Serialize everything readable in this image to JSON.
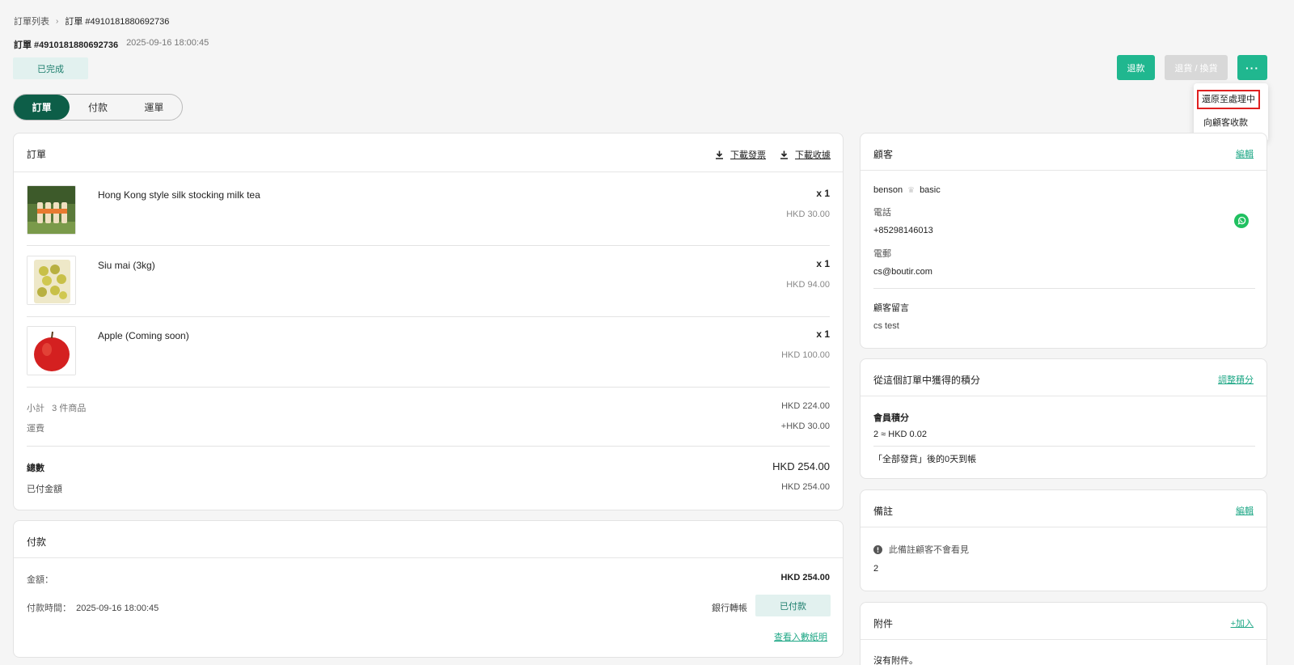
{
  "breadcrumb": {
    "parent": "訂單列表",
    "separator": "›",
    "current": "訂單 #4910181880692736"
  },
  "order": {
    "number": "訂單 #4910181880692736",
    "datetime": "2025-09-16 18:00:45",
    "status": "已完成"
  },
  "actions": {
    "refund": "退款",
    "return_exchange": "退貨 / 換貨",
    "more": "···"
  },
  "more_menu": {
    "items": [
      "還原至處理中",
      "向顧客收款"
    ]
  },
  "tabs": [
    "訂單",
    "付款",
    "運單"
  ],
  "order_card": {
    "title": "訂單",
    "download_invoice": "下載發票",
    "download_receipt": "下載收據",
    "items": [
      {
        "name": "Hong Kong style silk stocking milk tea",
        "qty": "x 1",
        "price": "HKD 30.00"
      },
      {
        "name": "Siu mai (3kg)",
        "qty": "x 1",
        "price": "HKD 94.00"
      },
      {
        "name": "Apple (Coming soon)",
        "qty": "x 1",
        "price": "HKD 100.00"
      }
    ],
    "subtotal_label": "小計",
    "subtotal_count": "3 件商品",
    "subtotal_value": "HKD 224.00",
    "shipping_label": "運費",
    "shipping_value": "+HKD 30.00",
    "total_label": "總數",
    "total_value": "HKD 254.00",
    "paid_label": "已付金額",
    "paid_value": "HKD 254.00"
  },
  "payment_card": {
    "title": "付款",
    "amount_label": "金額：",
    "amount_value": "HKD 254.00",
    "time_label": "付款時間：",
    "time_value": "2025-09-16 18:00:45",
    "method": "銀行轉帳",
    "status": "已付款",
    "view_link": "查看入數紙明"
  },
  "customer_card": {
    "title": "顧客",
    "edit": "編輯",
    "name": "benson",
    "tier": "basic",
    "phone_label": "電話",
    "phone": "+85298146013",
    "email_label": "電郵",
    "email": "cs@boutir.com",
    "message_label": "顧客留言",
    "message": "cs test"
  },
  "points_card": {
    "title": "從這個訂單中獲得的積分",
    "adjust": "調整積分",
    "member_points_label": "會員積分",
    "member_points_value": "2 ≈ HKD 0.02",
    "note": "「全部發貨」後的0天到帳"
  },
  "remarks_card": {
    "title": "備註",
    "edit": "編輯",
    "hint": "此備註顧客不會看見",
    "value": "2"
  },
  "attachments_card": {
    "title": "附件",
    "add": "+加入",
    "empty": "沒有附件。"
  },
  "colors": {
    "accent": "#20b78f",
    "tab_active": "#0d5e48",
    "badge_bg": "#e2f1ef",
    "highlight": "#e02020"
  }
}
